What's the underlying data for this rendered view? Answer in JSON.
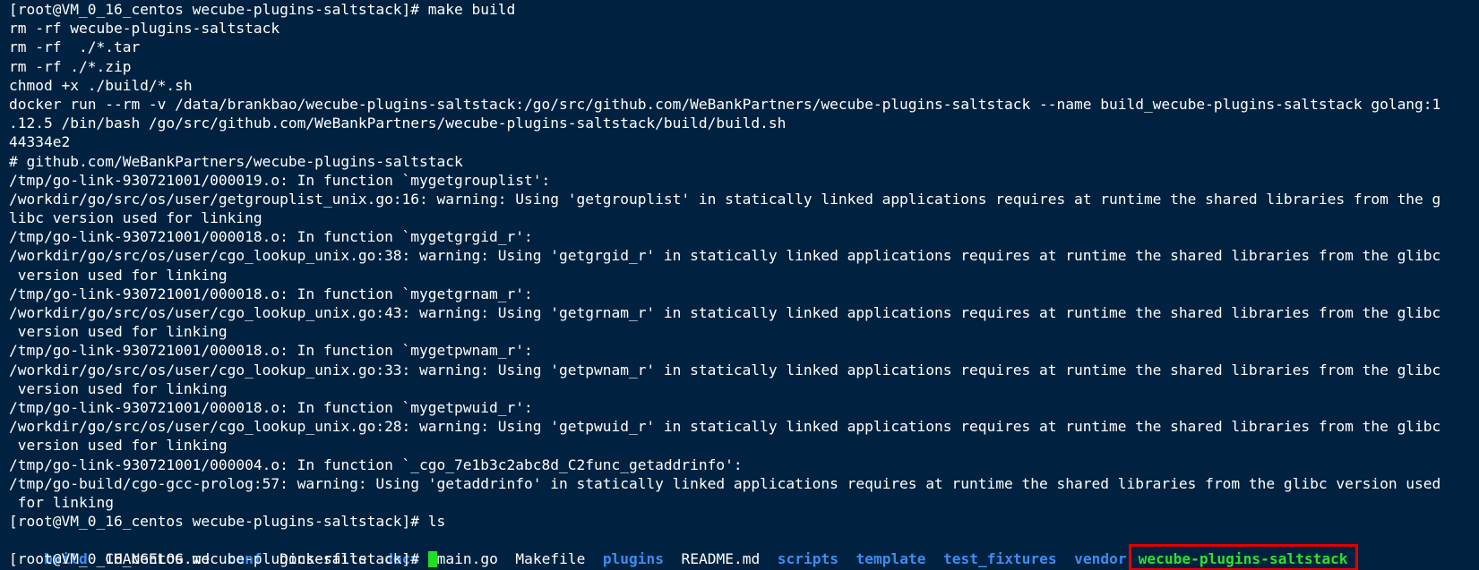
{
  "terminal": {
    "lines": [
      "[root@VM_0_16_centos wecube-plugins-saltstack]# make build",
      "rm -rf wecube-plugins-saltstack",
      "rm -rf  ./*.tar",
      "rm -rf ./*.zip",
      "chmod +x ./build/*.sh",
      "docker run --rm -v /data/brankbao/wecube-plugins-saltstack:/go/src/github.com/WeBankPartners/wecube-plugins-saltstack --name build_wecube-plugins-saltstack golang:1",
      ".12.5 /bin/bash /go/src/github.com/WeBankPartners/wecube-plugins-saltstack/build/build.sh",
      "44334e2",
      "# github.com/WeBankPartners/wecube-plugins-saltstack",
      "/tmp/go-link-930721001/000019.o: In function `mygetgrouplist':",
      "/workdir/go/src/os/user/getgrouplist_unix.go:16: warning: Using 'getgrouplist' in statically linked applications requires at runtime the shared libraries from the g",
      "libc version used for linking",
      "/tmp/go-link-930721001/000018.o: In function `mygetgrgid_r':",
      "/workdir/go/src/os/user/cgo_lookup_unix.go:38: warning: Using 'getgrgid_r' in statically linked applications requires at runtime the shared libraries from the glibc",
      " version used for linking",
      "/tmp/go-link-930721001/000018.o: In function `mygetgrnam_r':",
      "/workdir/go/src/os/user/cgo_lookup_unix.go:43: warning: Using 'getgrnam_r' in statically linked applications requires at runtime the shared libraries from the glibc",
      " version used for linking",
      "/tmp/go-link-930721001/000018.o: In function `mygetpwnam_r':",
      "/workdir/go/src/os/user/cgo_lookup_unix.go:33: warning: Using 'getpwnam_r' in statically linked applications requires at runtime the shared libraries from the glibc",
      " version used for linking",
      "/tmp/go-link-930721001/000018.o: In function `mygetpwuid_r':",
      "/workdir/go/src/os/user/cgo_lookup_unix.go:28: warning: Using 'getpwuid_r' in statically linked applications requires at runtime the shared libraries from the glibc",
      " version used for linking",
      "/tmp/go-link-930721001/000004.o: In function `_cgo_7e1b3c2abc8d_C2func_getaddrinfo':",
      "/tmp/go-build/cgo-gcc-prolog:57: warning: Using 'getaddrinfo' in statically linked applications requires at runtime the shared libraries from the glibc version used",
      " for linking",
      "[root@VM_0_16_centos wecube-plugins-saltstack]# ls"
    ],
    "ls_output": [
      {
        "name": "build",
        "kind": "dir"
      },
      {
        "name": "CHANGELOG.md",
        "kind": "file"
      },
      {
        "name": "conf",
        "kind": "dir"
      },
      {
        "name": "Dockerfile",
        "kind": "file"
      },
      {
        "name": "docs",
        "kind": "dir"
      },
      {
        "name": "main.go",
        "kind": "file"
      },
      {
        "name": "Makefile",
        "kind": "file"
      },
      {
        "name": "plugins",
        "kind": "dir"
      },
      {
        "name": "README.md",
        "kind": "file"
      },
      {
        "name": "scripts",
        "kind": "dir"
      },
      {
        "name": "template",
        "kind": "dir"
      },
      {
        "name": "test_fixtures",
        "kind": "dir"
      },
      {
        "name": "vendor",
        "kind": "dir"
      }
    ],
    "highlighted_entry": "wecube-plugins-saltstack",
    "prompt": "[root@VM_0_16_centos wecube-plugins-saltstack]# ",
    "colors": {
      "background": "#002240",
      "text": "#ffffff",
      "directory": "#3d8cf0",
      "executable": "#2ee02e",
      "highlight_box": "#e00000",
      "cursor": "#22dd22"
    }
  }
}
